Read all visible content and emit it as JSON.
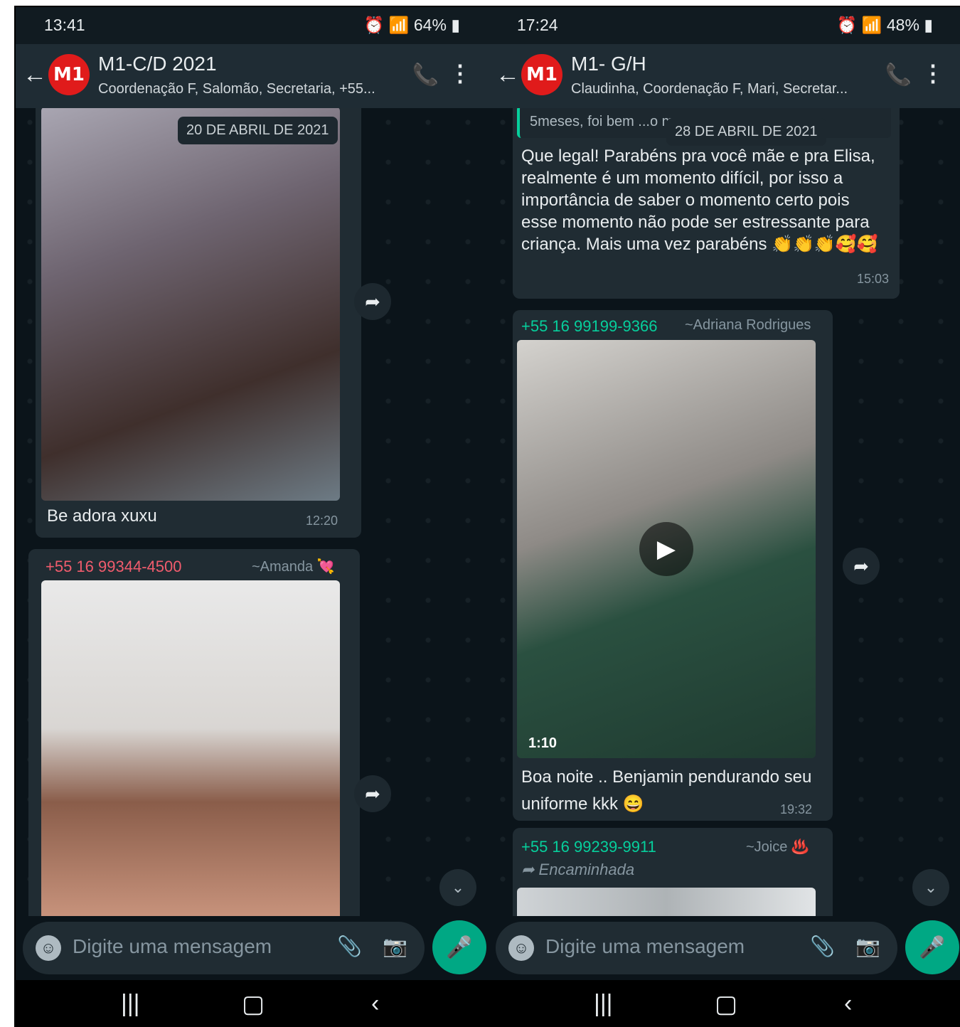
{
  "left": {
    "status": {
      "time": "13:41",
      "battery": "64%"
    },
    "header": {
      "avatar_text": "M1",
      "title": "M1-C/D 2021",
      "subtitle": "Coordenação F, Salomão, Secretaria, +55..."
    },
    "date_pill": "20 DE ABRIL DE 2021",
    "message1": {
      "text": "Be adora xuxu",
      "time": "12:20"
    },
    "message2": {
      "sender": "+55 16 99344-4500",
      "alias": "~Amanda 💘"
    },
    "input": {
      "placeholder": "Digite uma mensagem"
    }
  },
  "right": {
    "status": {
      "time": "17:24",
      "battery": "48%"
    },
    "header": {
      "avatar_text": "M1",
      "title": "M1- G/H",
      "subtitle": "Claudinha, Coordenação F, Mari, Secretar..."
    },
    "date_pill": "28 DE ABRIL DE 2021",
    "quote": {
      "text": "5meses, foi bem ...o mas co..."
    },
    "message1": {
      "text": "Que legal! Parabéns pra você mãe e pra Elisa, realmente é um momento difícil, por isso a importância de saber o momento certo pois esse momento não pode ser estressante para criança. Mais uma vez parabéns 👏👏👏🥰🥰",
      "time": "15:03"
    },
    "message2": {
      "sender": "+55 16 99199-9366",
      "alias": "~Adriana Rodrigues",
      "video_length": "1:10",
      "text": "Boa noite .. Benjamin pendurando seu uniforme kkk 😄",
      "time": "19:32"
    },
    "message3": {
      "sender": "+55 16 99239-9911",
      "alias": "~Joice ♨️",
      "forwarded_label": "Encaminhada"
    },
    "input": {
      "placeholder": "Digite uma mensagem"
    }
  },
  "colors": {
    "sender_pink": "#f15c6d",
    "sender_green": "#06cf9c",
    "accent": "#00a884"
  }
}
